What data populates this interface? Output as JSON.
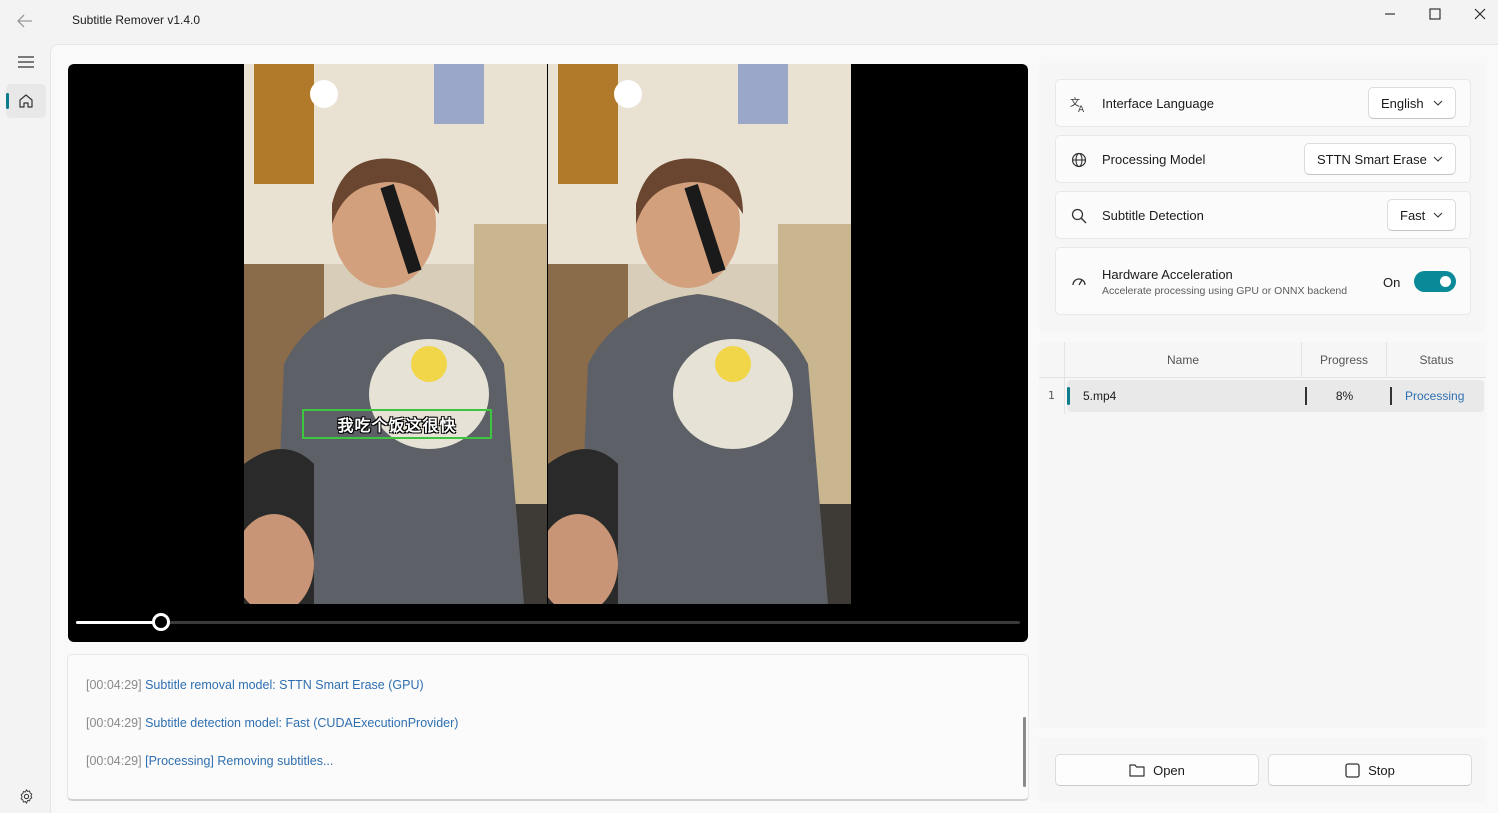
{
  "window": {
    "title": "Subtitle Remover v1.4.0"
  },
  "player": {
    "subtitle_overlay": "我吃个饭这很快",
    "seek_progress": 0.09
  },
  "log": {
    "lines": [
      {
        "time": "[00:04:29]",
        "message": "Subtitle removal model: STTN Smart Erase (GPU)"
      },
      {
        "time": "[00:04:29]",
        "message": "Subtitle detection model: Fast (CUDAExecutionProvider)"
      },
      {
        "time": "[00:04:29]",
        "message": "[Processing] Removing subtitles..."
      }
    ]
  },
  "settings": {
    "language": {
      "label": "Interface Language",
      "value": "English",
      "icon": "translate-icon"
    },
    "model": {
      "label": "Processing Model",
      "value": "STTN Smart Erase",
      "icon": "globe-icon"
    },
    "detection": {
      "label": "Subtitle Detection",
      "value": "Fast",
      "icon": "search-icon"
    },
    "hardware": {
      "label": "Hardware Acceleration",
      "description": "Accelerate processing using GPU or ONNX backend",
      "state_label": "On",
      "enabled": true,
      "icon": "speedometer-icon"
    }
  },
  "tasks": {
    "columns": [
      "Name",
      "Progress",
      "Status"
    ],
    "rows": [
      {
        "index": "1",
        "name": "5.mp4",
        "progress": "8%",
        "status": "Processing"
      }
    ]
  },
  "actions": {
    "open_label": "Open",
    "stop_label": "Stop"
  },
  "colors": {
    "accent": "#0a8a98",
    "link": "#2f6fb0",
    "subtitle_box": "#3ec43e"
  }
}
